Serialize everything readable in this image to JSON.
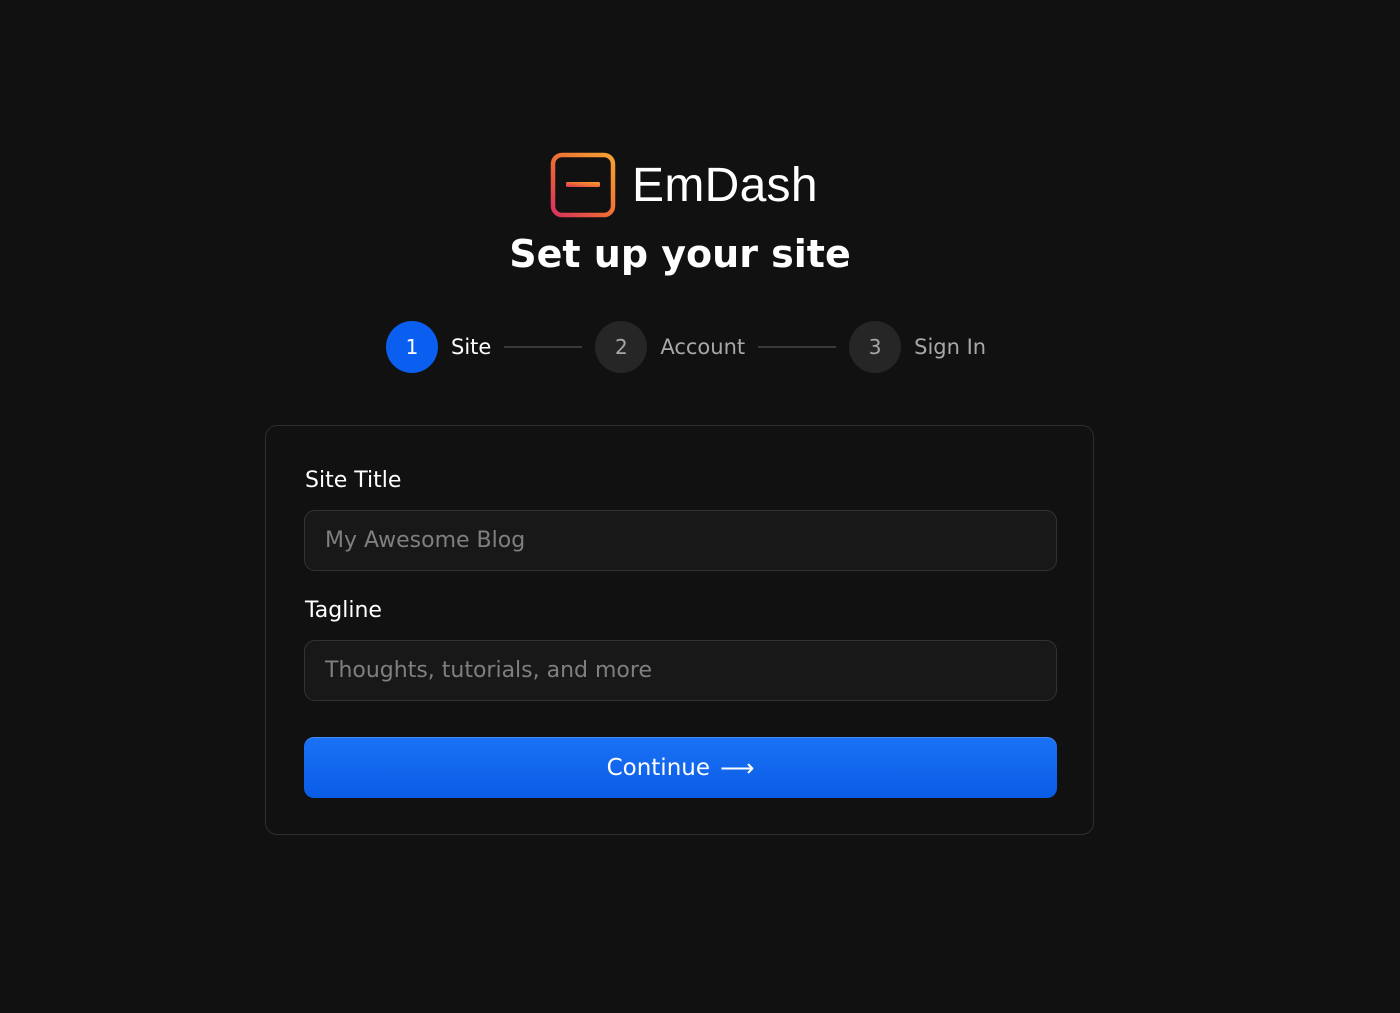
{
  "brand": {
    "name": "EmDash",
    "logo_icon": "emdash-logo-icon",
    "logo_gradient": [
      "#f7a431",
      "#e8593c",
      "#d8305e"
    ]
  },
  "page_title": "Set up your site",
  "steps": [
    {
      "number": "1",
      "label": "Site",
      "active": true
    },
    {
      "number": "2",
      "label": "Account",
      "active": false
    },
    {
      "number": "3",
      "label": "Sign In",
      "active": false
    }
  ],
  "form": {
    "site_title": {
      "label": "Site Title",
      "value": "",
      "placeholder": "My Awesome Blog"
    },
    "tagline": {
      "label": "Tagline",
      "value": "",
      "placeholder": "Thoughts, tutorials, and more"
    },
    "continue": {
      "label": "Continue",
      "icon": "arrow-right-icon",
      "arrow": "⟶"
    }
  },
  "colors": {
    "background": "#111111",
    "accent": "#0b5ff0",
    "inactive_step": "#262626"
  }
}
